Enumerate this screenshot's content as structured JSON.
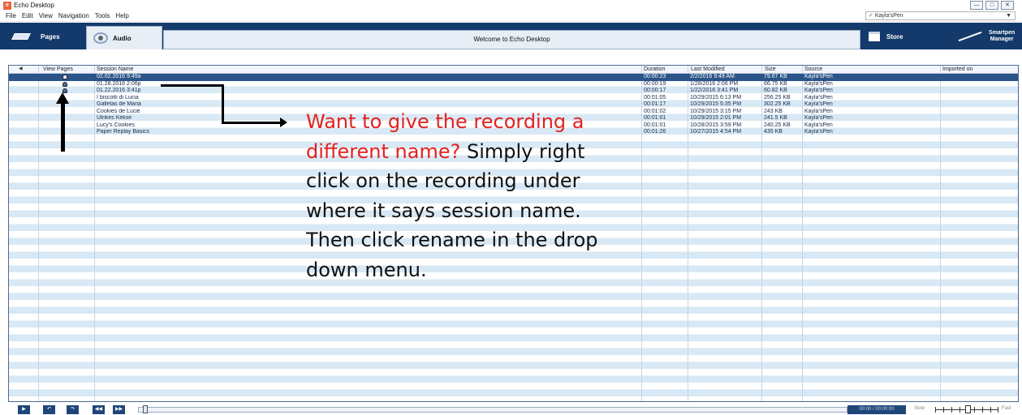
{
  "window": {
    "title": "Echo Desktop",
    "app_icon": "e",
    "buttons": [
      "minimize-icon",
      "maximize-icon",
      "close-icon"
    ]
  },
  "menu": [
    "File",
    "Edit",
    "View",
    "Navigation",
    "Tools",
    "Help"
  ],
  "pen_selector": {
    "value": "Kayla'sPen"
  },
  "toolbar": {
    "pages_label": "Pages",
    "audio_label": "Audio",
    "welcome_text": "Welcome to Echo Desktop",
    "store_label": "Store",
    "smartpen_label_line1": "Smartpen",
    "smartpen_label_line2": "Manager"
  },
  "table": {
    "columns": [
      "View Pages",
      "Session Name",
      "Duration",
      "Last Modified",
      "Size",
      "Source",
      "Imported on"
    ],
    "rows": [
      {
        "name": "02.02.2016 9:49a",
        "duration": "00:00:23",
        "modified": "2/2/2016 9:49 AM",
        "size": "79.67 KB",
        "source": "Kayla'sPen",
        "has_pages": true,
        "selected": true
      },
      {
        "name": "01.28.2016 2:06p",
        "duration": "00:00:19",
        "modified": "1/28/2016 2:06 PM",
        "size": "66.75 KB",
        "source": "Kayla'sPen",
        "has_pages": true,
        "selected": false
      },
      {
        "name": "01.22.2016 3:41p",
        "duration": "00:00:17",
        "modified": "1/22/2016 3:41 PM",
        "size": "60.82 KB",
        "source": "Kayla'sPen",
        "has_pages": true,
        "selected": false
      },
      {
        "name": "I biscotti di Lucia",
        "duration": "00:01:05",
        "modified": "10/29/2015 6:13 PM",
        "size": "256.25 KB",
        "source": "Kayla'sPen",
        "has_pages": false,
        "selected": false
      },
      {
        "name": "Galletas de Maria",
        "duration": "00:01:17",
        "modified": "10/29/2015 5:35 PM",
        "size": "302.25 KB",
        "source": "Kayla'sPen",
        "has_pages": false,
        "selected": false
      },
      {
        "name": "Cookies de Lucie",
        "duration": "00:01:02",
        "modified": "10/29/2015 3:15 PM",
        "size": "243 KB",
        "source": "Kayla'sPen",
        "has_pages": false,
        "selected": false
      },
      {
        "name": "Utrikes Kekse",
        "duration": "00:01:01",
        "modified": "10/29/2015 2:01 PM",
        "size": "241.5 KB",
        "source": "Kayla'sPen",
        "has_pages": false,
        "selected": false
      },
      {
        "name": "Lucy's Cookies",
        "duration": "00:01:01",
        "modified": "10/28/2015 3:59 PM",
        "size": "240.25 KB",
        "source": "Kayla'sPen",
        "has_pages": false,
        "selected": false
      },
      {
        "name": "Paper Replay Basics",
        "duration": "00:01:26",
        "modified": "10/27/2015 4:54 PM",
        "size": "435 KB",
        "source": "Kayla'sPen",
        "has_pages": false,
        "selected": false
      }
    ]
  },
  "annotation": {
    "red_text": "Want to give the recording a different name?",
    "black_text": "Simply right click on the recording under where it says session name. Then click rename in the drop down menu."
  },
  "playbar": {
    "time": "00:00 / 00:00:00",
    "speed_slow": "Slow",
    "speed_fast": "Fast",
    "speed_level": 0.5
  },
  "colors": {
    "accent": "#133a6a",
    "selection": "#2b5488",
    "annotation_red": "#e4211f"
  }
}
